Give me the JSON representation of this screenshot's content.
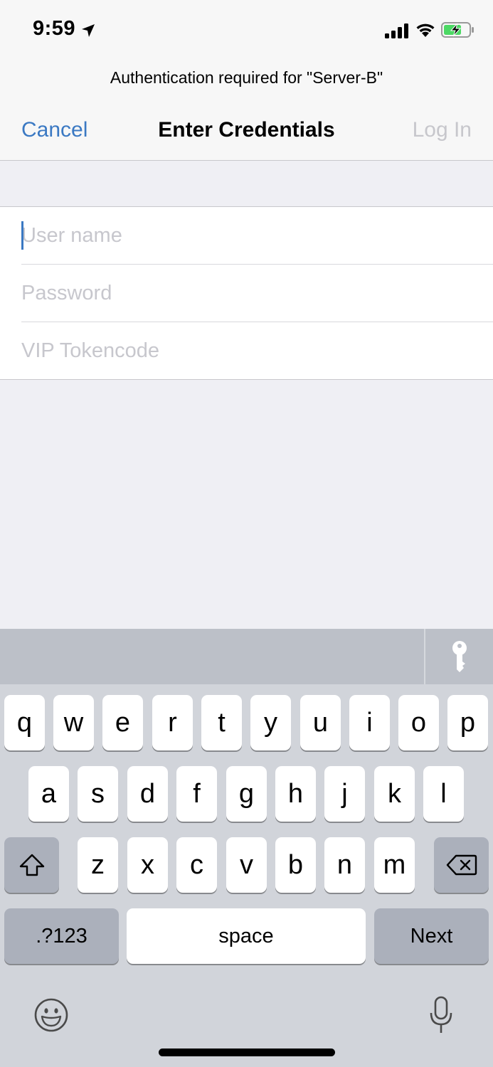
{
  "status_bar": {
    "time": "9:59",
    "icons": [
      "location-arrow-icon",
      "signal-icon",
      "wifi-icon",
      "battery-charging-icon"
    ]
  },
  "dialog": {
    "prompt": "Authentication required for \"Server-B\"",
    "cancel_label": "Cancel",
    "title": "Enter Credentials",
    "login_label": "Log In"
  },
  "form": {
    "username": {
      "value": "",
      "placeholder": "User name"
    },
    "password": {
      "value": "",
      "placeholder": "Password"
    },
    "token": {
      "value": "",
      "placeholder": "VIP Tokencode"
    }
  },
  "keyboard": {
    "row1": [
      "q",
      "w",
      "e",
      "r",
      "t",
      "y",
      "u",
      "i",
      "o",
      "p"
    ],
    "row2": [
      "a",
      "s",
      "d",
      "f",
      "g",
      "h",
      "j",
      "k",
      "l"
    ],
    "row3": [
      "z",
      "x",
      "c",
      "v",
      "b",
      "n",
      "m"
    ],
    "numbers_label": ".?123",
    "space_label": "space",
    "next_label": "Next",
    "toolbar_icon": "key-icon",
    "accent_color": "#3b79c3"
  }
}
